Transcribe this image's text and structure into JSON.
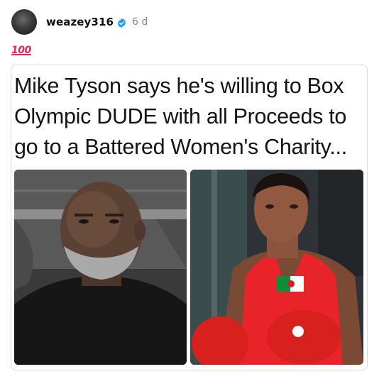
{
  "post": {
    "username": "weazey316",
    "timestamp": "6 d",
    "verified": true,
    "caption_emoji": "💯",
    "caption_emoji_text": "100"
  },
  "card": {
    "headline": "Mike Tyson says he's willing to Box Olympic DUDE with all Proceeds to go to a Battered Women's Charity..."
  },
  "colors": {
    "verified_badge": "#1d9bf0",
    "emoji_red": "#e0245e",
    "timestamp_gray": "#8a8a8a",
    "jersey_red": "#e8242a",
    "glove_red": "#d8201f"
  },
  "icons": {
    "verified": "verified-badge-icon",
    "hundred": "hundred-points-icon"
  }
}
